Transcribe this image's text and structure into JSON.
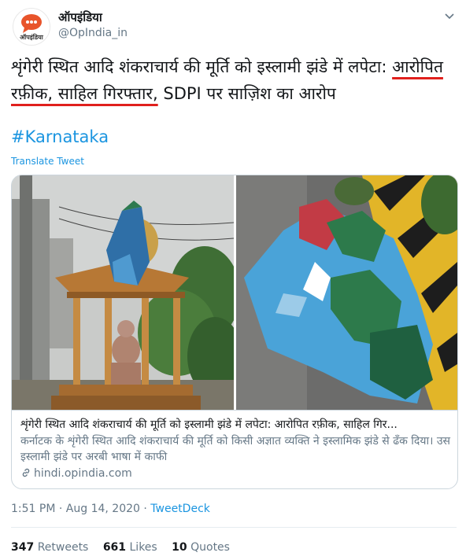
{
  "account": {
    "name": "ऑपइंडिया",
    "handle": "@OpIndia_in",
    "avatar_text": "ऑपइंडिया"
  },
  "tweet": {
    "text_part1": "शृंगेरी स्थित आदि शंकराचार्य की मूर्ति को इस्लामी झंडे में लपेटा: ",
    "text_underlined": "आरोपित रफ़ीक, साहिल गिरफ्तार,",
    "text_part2": " SDPI पर साज़िश का आरोप",
    "hashtag": "#Karnataka",
    "translate": "Translate Tweet"
  },
  "card": {
    "title": "शृंगेरी स्थित आदि शंकराचार्य की मूर्ति को इस्लामी झंडे में लपेटा: आरोपित रफ़ीक, साहिल गिर...",
    "description": "कर्नाटक के शृंगेरी स्थित आदि शंकराचार्य की मूर्ति को किसी अज्ञात व्यक्ति ने इस्लामिक झंडे से ढँक दिया। उस इस्लामी झंडे पर अरबी भाषा में काफी",
    "domain": "hindi.opindia.com"
  },
  "meta": {
    "time": "1:51 PM",
    "separator": " · ",
    "date": "Aug 14, 2020",
    "separator2": " · ",
    "app": "TweetDeck"
  },
  "stats": {
    "retweets_count": "347",
    "retweets_label": "Retweets",
    "likes_count": "661",
    "likes_label": "Likes",
    "quotes_count": "10",
    "quotes_label": "Quotes"
  },
  "colors": {
    "link": "#1b95e0",
    "underline": "#e0201d",
    "secondary_text": "#657786",
    "avatar_bubble": "#e8542b"
  }
}
